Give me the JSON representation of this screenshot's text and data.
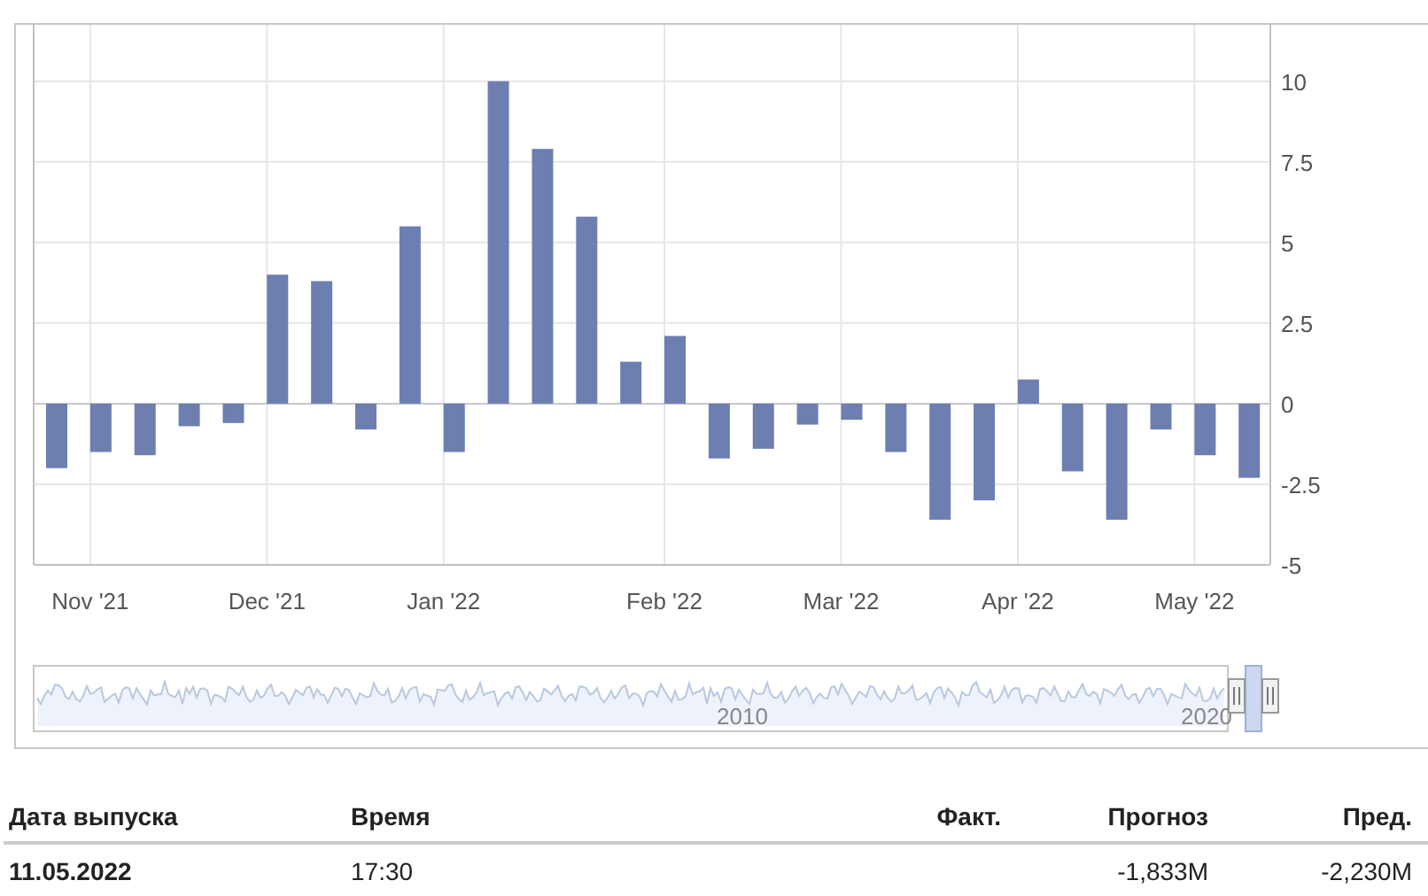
{
  "chart": {
    "chart_data": {
      "type": "bar",
      "categories": [
        null,
        "Nov '21",
        null,
        null,
        null,
        "Dec '21",
        null,
        null,
        null,
        "Jan '22",
        null,
        null,
        null,
        null,
        "Feb '22",
        null,
        null,
        null,
        "Mar '22",
        null,
        null,
        null,
        "Apr '22",
        null,
        null,
        null,
        "May '22",
        null
      ],
      "series": [
        {
          "color": "#6c7fb0",
          "values": [
            -2.0,
            -1.5,
            -1.6,
            -0.7,
            -0.6,
            4.0,
            3.8,
            -0.8,
            5.5,
            -1.5,
            10.0,
            7.9,
            5.8,
            1.3,
            2.1,
            -1.7,
            -1.4,
            -0.65,
            -0.5,
            -1.5,
            -3.6,
            -3.0,
            0.75,
            -2.1,
            -3.6,
            -0.8,
            -1.6,
            -2.3
          ]
        }
      ],
      "ylim": [
        -5,
        11.75
      ],
      "grid": true,
      "yticks": [
        {
          "value": -5,
          "label": "-5"
        },
        {
          "value": -2.5,
          "label": "-2.5"
        },
        {
          "value": 0,
          "label": "0"
        },
        {
          "value": 2.5,
          "label": "2.5"
        },
        {
          "value": 5,
          "label": "5"
        },
        {
          "value": 7.5,
          "label": "7.5"
        },
        {
          "value": 10,
          "label": "10"
        }
      ]
    },
    "navigator": {
      "labels": [
        "2010",
        "2020"
      ]
    }
  },
  "table": {
    "columns": [
      "Дата выпуска",
      "Время",
      "Факт.",
      "Прогноз",
      "Пред."
    ],
    "rows": [
      {
        "date": "11.05.2022",
        "time": "17:30",
        "forecast": "-1,833M",
        "previous": "-2,230M"
      }
    ]
  }
}
